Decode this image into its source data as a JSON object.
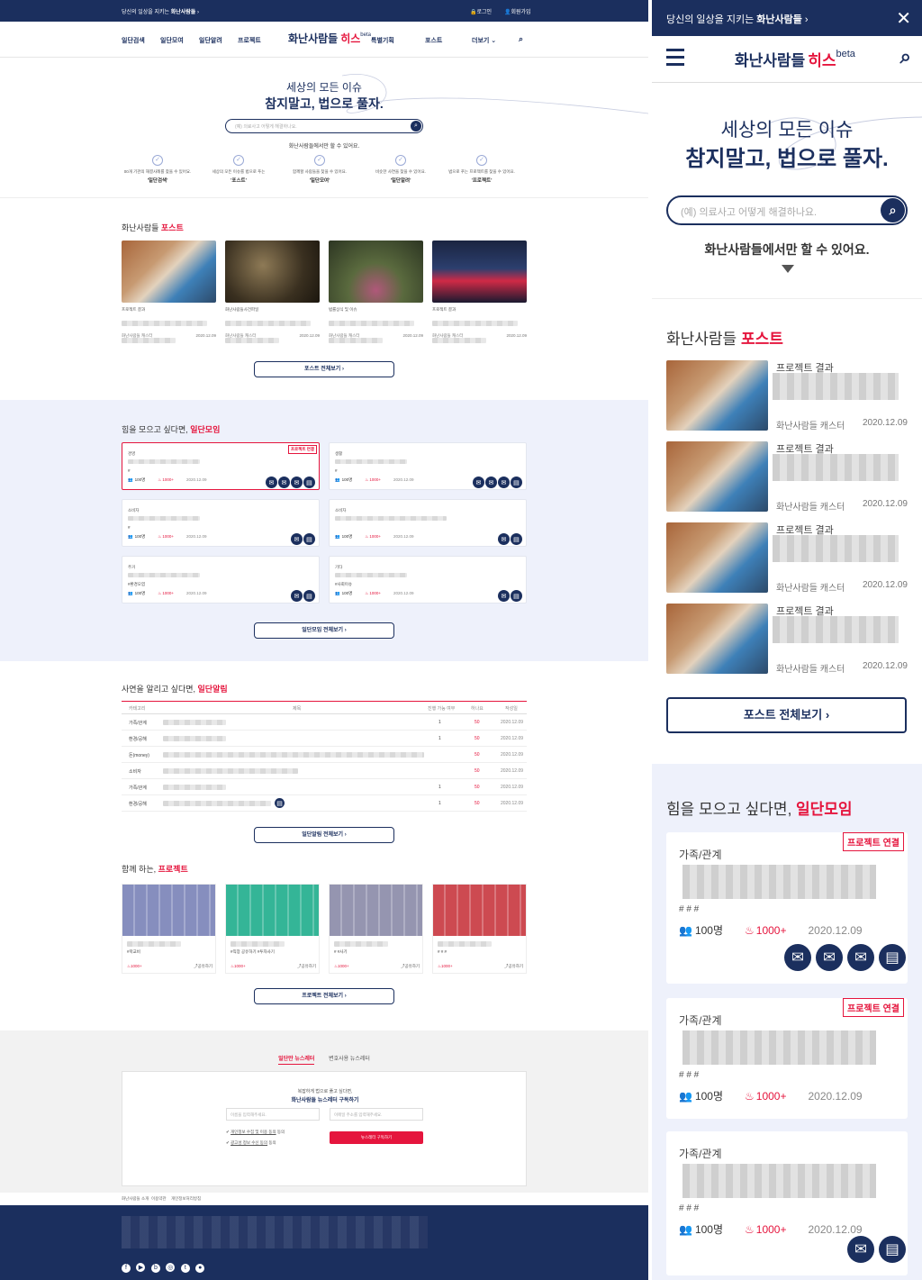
{
  "topbar": {
    "notice_prefix": "당신의 일상을 지키는 ",
    "notice_brand": "화난사람들",
    "login": "로그인",
    "signup": "회원가입"
  },
  "nav": {
    "items": [
      "일단검색",
      "일단모여",
      "일단알려",
      "프로젝트",
      "특별기획",
      "포스트"
    ],
    "more": "더보기",
    "logo_text": "화난사람들",
    "logo_mark": "히스",
    "logo_beta": "beta"
  },
  "hero": {
    "line1": "세상의 모든 이슈",
    "line2": "참지말고, 법으로 풀자.",
    "search_placeholder": "(예) 의료사고 어떻게 해결하나요.",
    "tagline": "화난사람들에서만 할 수 있어요."
  },
  "features": [
    {
      "desc": "00개 기관의 해결사례를 찾을 수 있어요.",
      "name": "'일단검색'"
    },
    {
      "desc": "세상의 모든 이슈를 법으로 푸는",
      "name": "'포스트'"
    },
    {
      "desc": "함께할 사람들을 찾을 수 있어요.",
      "name": "'일단모여'"
    },
    {
      "desc": "비슷한 사연을 찾을 수 있어요.",
      "name": "'일단알려'"
    },
    {
      "desc": "법으로 푸는 프로젝트를 찾을 수 있어요.",
      "name": "'프로젝트'"
    }
  ],
  "posts": {
    "heading_prefix": "화난사람들 ",
    "heading_accent": "포스트",
    "more": "포스트 전체보기",
    "items": [
      {
        "category": "프로젝트 결과",
        "author": "화난사람들 캐스터",
        "date": "2020.12.09"
      },
      {
        "category": "화난사람들사건파일",
        "author": "화난사람들 캐스터",
        "date": "2020.12.09"
      },
      {
        "category": "법률상식 및 이슈",
        "author": "화난사람들 캐스터",
        "date": "2020.12.09"
      },
      {
        "category": "프로젝트 결과",
        "author": "화난사람들 캐스터",
        "date": "2020.12.09"
      }
    ]
  },
  "gather": {
    "heading_prefix": "힘을 모으고 싶다면, ",
    "heading_accent": "일단모임",
    "more": "일단모임 전체보기",
    "badge": "프로젝트 연결",
    "cards": [
      {
        "category": "경영",
        "people": "100명",
        "hot": "1000+",
        "date": "2020.12.09",
        "tags": "#",
        "badge": true,
        "icons": 4
      },
      {
        "category": "생활",
        "people": "100명",
        "hot": "1000+",
        "date": "2020.12.09",
        "tags": "#",
        "badge": false,
        "icons": 4
      },
      {
        "category": "소비자",
        "people": "100명",
        "hot": "1000+",
        "date": "2020.12.09",
        "tags": "#",
        "badge": false,
        "icons": 2
      },
      {
        "category": "소비자",
        "people": "100명",
        "hot": "1000+",
        "date": "2020.12.09",
        "tags": "",
        "badge": false,
        "icons": 2
      },
      {
        "category": "주거",
        "people": "100명",
        "hot": "1000+",
        "date": "2020.12.09",
        "tags": "#환경오염",
        "badge": false,
        "icons": 2
      },
      {
        "category": "기타",
        "people": "100명",
        "hot": "1000+",
        "date": "2020.12.09",
        "tags": "#사회이슈",
        "badge": false,
        "icons": 2
      }
    ]
  },
  "alert": {
    "heading_prefix": "사연을 알리고 싶다면, ",
    "heading_accent": "일단알림",
    "more": "일단알림 전체보기",
    "columns": [
      "카테고리",
      "제목",
      "진행 가능 여부",
      "하나요",
      "작성일"
    ],
    "rows": [
      {
        "cat": "가족/관계",
        "n": "1",
        "v": "50",
        "date": "2020.12.09"
      },
      {
        "cat": "환경/공해",
        "n": "1",
        "v": "50",
        "date": "2020.12.09"
      },
      {
        "cat": "돈(money)",
        "n": "",
        "v": "50",
        "date": "2020.12.09"
      },
      {
        "cat": "소비자",
        "n": "",
        "v": "50",
        "date": "2020.12.09"
      },
      {
        "cat": "가족/관계",
        "n": "1",
        "v": "50",
        "date": "2020.12.09"
      },
      {
        "cat": "환경/공해",
        "n": "1",
        "v": "50",
        "date": "2020.12.09"
      }
    ]
  },
  "projects": {
    "heading_prefix": "함께 하는, ",
    "heading_accent": "프로젝트",
    "more": "프로젝트 전체보기",
    "items": [
      {
        "tag": "#학교비",
        "hot": "1000+",
        "share": "공유하기",
        "color": "#7a82b8"
      },
      {
        "tag": "#직장 공유하기 #투자사기",
        "hot": "1000+",
        "share": "공유하기",
        "color": "#1fae8c"
      },
      {
        "tag": "# #사기",
        "hot": "1000+",
        "share": "공유하기",
        "color": "#8a8aa8"
      },
      {
        "tag": "# # #",
        "hot": "1000+",
        "share": "공유하기",
        "color": "#c8373f"
      }
    ]
  },
  "newsletter": {
    "tab_active": "일단만 뉴스레터",
    "tab_other": "변호사용 뉴스레터",
    "line1": "복잡하게 법으로 풀고 싶다면,",
    "line2": "화난사람들 뉴스레터 구독하기",
    "name_placeholder": "이름을 입력해주세요.",
    "email_placeholder": "이메일 주소를 입력해주세요.",
    "agree1": "개인정보 수집 및 이용 동의",
    "agree2": "광고성 정보 수신 동의",
    "agree_suffix": "동의",
    "subscribe": "뉴스레터 구독하기"
  },
  "footer": {
    "links": [
      "화난사람들 소개",
      "이용약관",
      "개인정보처리방침"
    ]
  },
  "mobile": {
    "notice_prefix": "당신의 일상을 지키는 ",
    "notice_brand": "화난사람들",
    "tagline": "화난사람들에서만 할 수 있어요.",
    "search_placeholder": "(예) 의료사고 어떻게 해결하나요.",
    "posts": [
      {
        "category": "프로젝트 결과",
        "author": "화난사람들 캐스터",
        "date": "2020.12.09"
      },
      {
        "category": "프로젝트 결과",
        "author": "화난사람들 캐스터",
        "date": "2020.12.09"
      },
      {
        "category": "프로젝트 결과",
        "author": "화난사람들 캐스터",
        "date": "2020.12.09"
      },
      {
        "category": "프로젝트 결과",
        "author": "화난사람들 캐스터",
        "date": "2020.12.09"
      }
    ],
    "gather": [
      {
        "category": "가족/관계",
        "people": "100명",
        "hot": "1000+",
        "date": "2020.12.09",
        "badge": true,
        "icons": 4
      },
      {
        "category": "가족/관계",
        "people": "100명",
        "hot": "1000+",
        "date": "2020.12.09",
        "badge": true,
        "icons": 0
      },
      {
        "category": "가족/관계",
        "people": "100명",
        "hot": "1000+",
        "date": "2020.12.09",
        "badge": false,
        "icons": 2
      }
    ]
  },
  "colors": {
    "navy": "#1b2f5e",
    "accent": "#e5153d",
    "light_blue_bg": "#eef1fb",
    "gray_bg": "#f2f2f2"
  }
}
